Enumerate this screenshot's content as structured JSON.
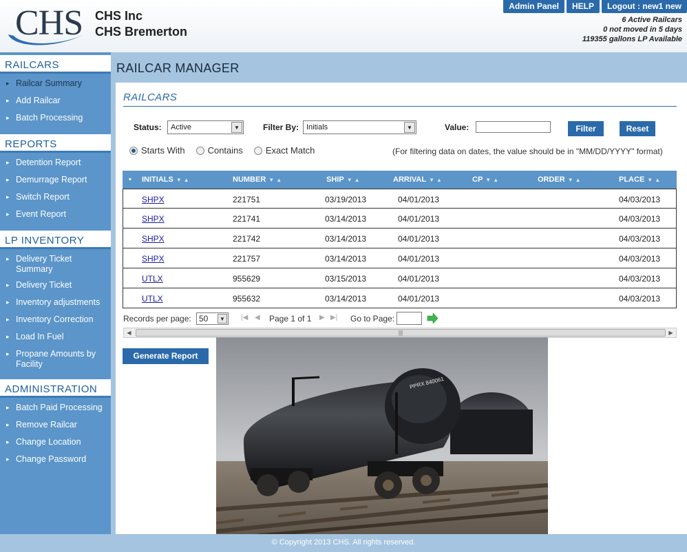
{
  "header": {
    "logo_text": "CHS",
    "company_name": "CHS Inc",
    "location": "CHS Bremerton",
    "buttons": {
      "admin_panel": "Admin Panel",
      "help": "HELP",
      "logout": "Logout : new1 new"
    },
    "stats": {
      "active_railcars": "6 Active Railcars",
      "not_moved": "0 not moved in 5 days",
      "lp_available": "119355 gallons LP Available"
    }
  },
  "sidebar": {
    "sections": [
      {
        "title": "RAILCARS",
        "items": [
          "Railcar Summary",
          "Add Railcar",
          "Batch Processing"
        ]
      },
      {
        "title": "REPORTS",
        "items": [
          "Detention Report",
          "Demurrage Report",
          "Switch Report",
          "Event Report"
        ]
      },
      {
        "title": "LP INVENTORY",
        "items": [
          "Delivery Ticket Summary",
          "Delivery Ticket",
          "Inventory adjustments",
          "Inventory Correction",
          "Load In Fuel",
          "Propane Amounts by Facility"
        ]
      },
      {
        "title": "ADMINISTRATION",
        "items": [
          "Batch Paid Processing",
          "Remove Railcar",
          "Change Location",
          "Change Password"
        ]
      }
    ]
  },
  "main": {
    "title": "RAILCAR MANAGER",
    "subheading": "RAILCARS",
    "filters": {
      "status_label": "Status:",
      "status_value": "Active",
      "filter_by_label": "Filter By:",
      "filter_by_value": "Initials",
      "value_label": "Value:",
      "value_input": "",
      "filter_button": "Filter",
      "reset_button": "Reset",
      "match_options": [
        "Starts With",
        "Contains",
        "Exact Match"
      ],
      "selected_match": "Starts With",
      "hint": "(For filtering data on dates, the value should be in \"MM/DD/YYYY\" format)"
    },
    "table": {
      "columns": [
        "INITIALS",
        "NUMBER",
        "SHIP",
        "ARRIVAL",
        "CP",
        "ORDER",
        "PLACE"
      ],
      "rows": [
        {
          "initials": "SHPX",
          "number": "221751",
          "ship": "03/19/2013",
          "arrival": "04/01/2013",
          "cp": "",
          "order": "",
          "place": "04/03/2013"
        },
        {
          "initials": "SHPX",
          "number": "221741",
          "ship": "03/14/2013",
          "arrival": "04/01/2013",
          "cp": "",
          "order": "",
          "place": "04/03/2013"
        },
        {
          "initials": "SHPX",
          "number": "221742",
          "ship": "03/14/2013",
          "arrival": "04/01/2013",
          "cp": "",
          "order": "",
          "place": "04/03/2013"
        },
        {
          "initials": "SHPX",
          "number": "221757",
          "ship": "03/14/2013",
          "arrival": "04/01/2013",
          "cp": "",
          "order": "",
          "place": "04/03/2013"
        },
        {
          "initials": "UTLX",
          "number": "955629",
          "ship": "03/15/2013",
          "arrival": "04/01/2013",
          "cp": "",
          "order": "",
          "place": "04/03/2013"
        },
        {
          "initials": "UTLX",
          "number": "955632",
          "ship": "03/14/2013",
          "arrival": "04/01/2013",
          "cp": "",
          "order": "",
          "place": "04/03/2013"
        }
      ]
    },
    "pager": {
      "records_label": "Records per page:",
      "records_value": "50",
      "page_text": "Page 1 of 1",
      "goto_label": "Go to Page:",
      "goto_value": ""
    },
    "generate_report_button": "Generate Report",
    "photo_tank_text": "PPRX 840061"
  },
  "footer": {
    "copyright": "© Copyright 2013 CHS. All rights reserved."
  },
  "colors": {
    "brand_blue": "#2b6aaa",
    "sidebar_blue": "#5b95c9",
    "band_blue": "#a5c4e0"
  }
}
